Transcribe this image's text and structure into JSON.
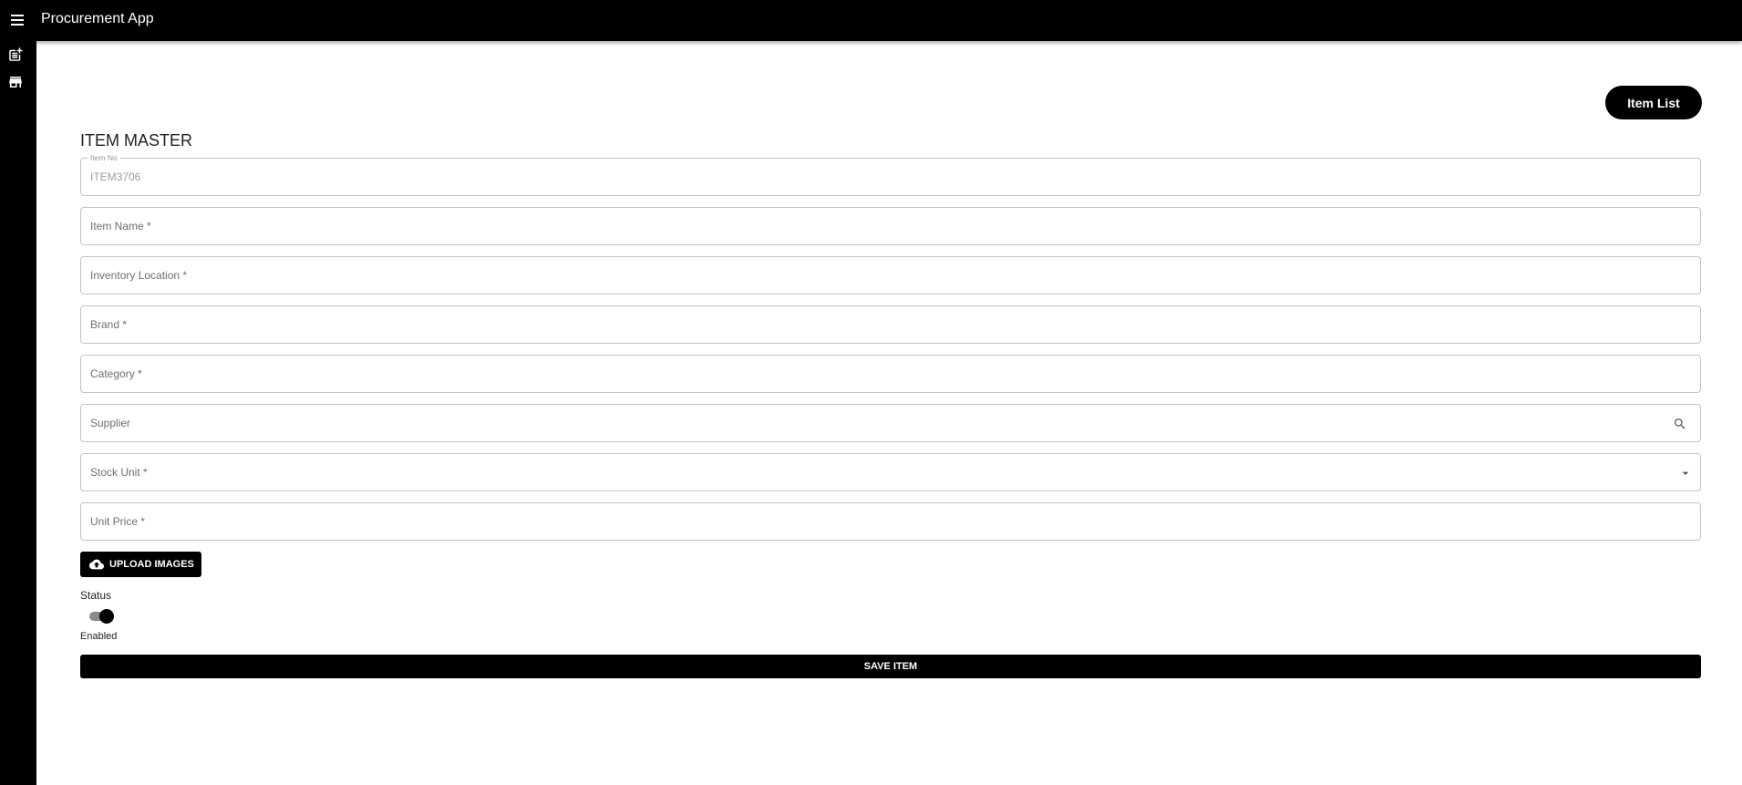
{
  "app": {
    "title": "Procurement App"
  },
  "sidebar": {
    "items": [
      {
        "icon": "post-add-icon"
      },
      {
        "icon": "store-icon"
      }
    ]
  },
  "header": {
    "item_list_button": "Item List"
  },
  "form": {
    "title": "ITEM MASTER",
    "fields": {
      "item_no": {
        "label": "Item No",
        "value": "ITEM3706"
      },
      "item_name": {
        "label": "Item Name *",
        "value": ""
      },
      "inventory_location": {
        "label": "Inventory Location *",
        "value": ""
      },
      "brand": {
        "label": "Brand *",
        "value": ""
      },
      "category": {
        "label": "Category *",
        "value": ""
      },
      "supplier": {
        "label": "Supplier",
        "value": "",
        "icon": "search-icon"
      },
      "stock_unit": {
        "label": "Stock Unit *",
        "value": "",
        "icon": "arrow-drop-down-icon"
      },
      "unit_price": {
        "label": "Unit Price *",
        "value": ""
      }
    },
    "upload_button": {
      "label": "UPLOAD IMAGES",
      "icon": "cloud-upload-icon"
    },
    "status": {
      "label": "Status",
      "enabled": true,
      "state_text": "Enabled"
    },
    "save_button": "SAVE ITEM"
  },
  "colors": {
    "appbar": "#000000",
    "button": "#000000",
    "border": "#c4c4c4"
  }
}
